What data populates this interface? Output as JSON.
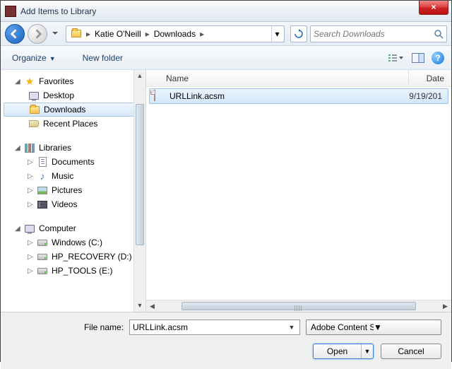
{
  "window": {
    "title": "Add Items to Library",
    "close_glyph": "×"
  },
  "nav": {
    "crumbs": [
      "Katie O'Neill",
      "Downloads"
    ],
    "search_placeholder": "Search Downloads"
  },
  "toolbar": {
    "organize": "Organize",
    "newfolder": "New folder",
    "help": "?"
  },
  "sidebar": {
    "favorites": {
      "label": "Favorites",
      "items": [
        {
          "label": "Desktop",
          "icon": "desktop"
        },
        {
          "label": "Downloads",
          "icon": "downloads",
          "selected": true
        },
        {
          "label": "Recent Places",
          "icon": "recent"
        }
      ]
    },
    "libraries": {
      "label": "Libraries",
      "items": [
        {
          "label": "Documents",
          "icon": "doc"
        },
        {
          "label": "Music",
          "icon": "music"
        },
        {
          "label": "Pictures",
          "icon": "pic"
        },
        {
          "label": "Videos",
          "icon": "vid"
        }
      ]
    },
    "computer": {
      "label": "Computer",
      "items": [
        {
          "label": "Windows (C:)",
          "icon": "drive"
        },
        {
          "label": "HP_RECOVERY (D:)",
          "icon": "drive"
        },
        {
          "label": "HP_TOOLS (E:)",
          "icon": "drive"
        }
      ]
    }
  },
  "columns": {
    "name": "Name",
    "date": "Date mo"
  },
  "files": [
    {
      "name": "URLLink.acsm",
      "date": "9/19/201",
      "selected": true
    }
  ],
  "footer": {
    "filename_label": "File name:",
    "filename_value": "URLLink.acsm",
    "filter": "Adobe Content Server Message",
    "open": "Open",
    "cancel": "Cancel"
  }
}
